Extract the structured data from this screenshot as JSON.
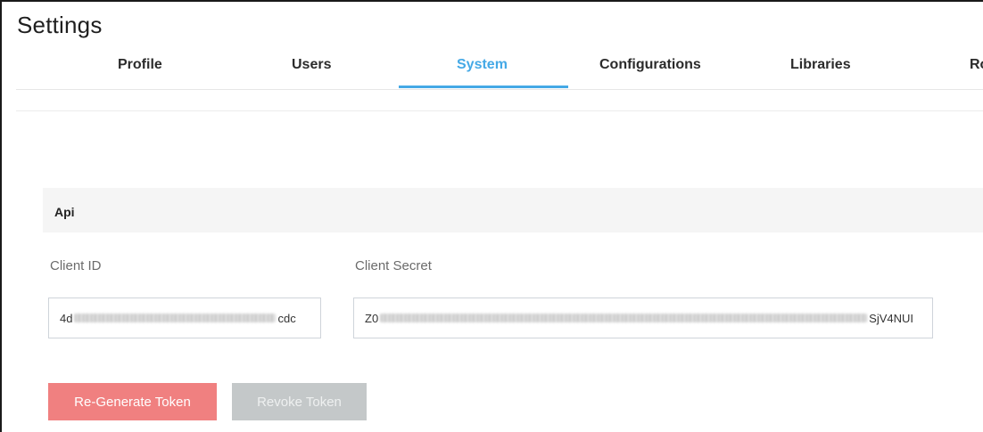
{
  "page": {
    "title": "Settings"
  },
  "tabs": [
    {
      "label": "Profile",
      "active": false
    },
    {
      "label": "Users",
      "active": false
    },
    {
      "label": "System",
      "active": true
    },
    {
      "label": "Configurations",
      "active": false
    },
    {
      "label": "Libraries",
      "active": false
    },
    {
      "label": "Ro",
      "active": false
    }
  ],
  "api": {
    "section_title": "Api",
    "client_id": {
      "label": "Client ID",
      "value_start": "4d",
      "value_end": "cdc"
    },
    "client_secret": {
      "label": "Client Secret",
      "value_start": "Z0",
      "value_end": "SjV4NUI"
    }
  },
  "actions": {
    "regenerate_label": "Re-Generate Token",
    "revoke_label": "Revoke Token"
  },
  "colors": {
    "accent": "#45a9e6",
    "primary_button": "#f08080",
    "disabled_button": "#c4c8c9"
  }
}
